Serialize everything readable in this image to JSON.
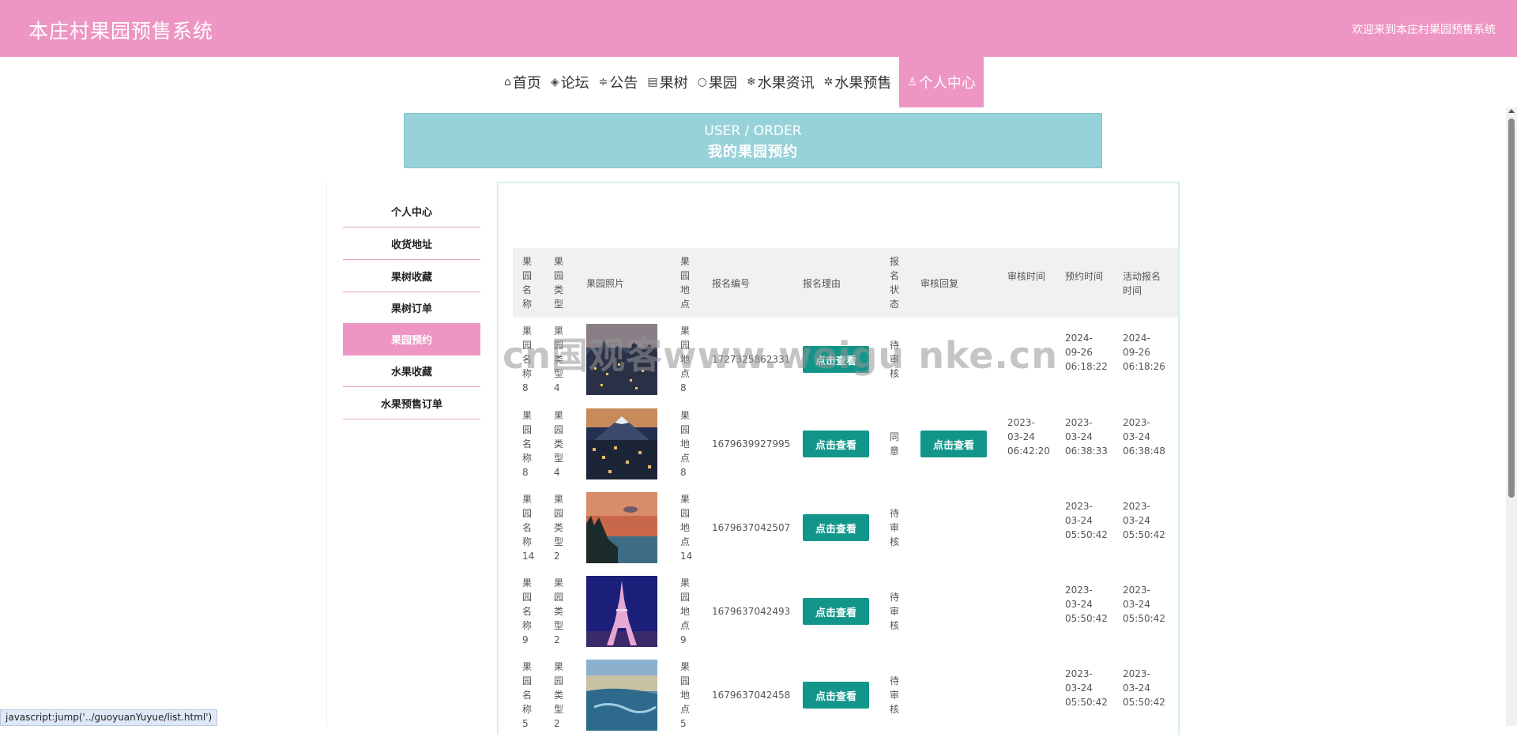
{
  "header": {
    "title": "本庄村果园预售系统",
    "welcome": "欢迎来到本庄村果园预售系统"
  },
  "nav": [
    {
      "icon": "home-icon",
      "glyph": "⌂",
      "label": "首页"
    },
    {
      "icon": "forum-icon",
      "glyph": "◈",
      "label": "论坛"
    },
    {
      "icon": "notice-icon",
      "glyph": "≑",
      "label": "公告"
    },
    {
      "icon": "tree-icon",
      "glyph": "▤",
      "label": "果树"
    },
    {
      "icon": "orchard-icon",
      "glyph": "○",
      "label": "果园"
    },
    {
      "icon": "news-icon",
      "glyph": "❄",
      "label": "水果资讯"
    },
    {
      "icon": "presale-icon",
      "glyph": "✲",
      "label": "水果预售"
    },
    {
      "icon": "user-icon",
      "glyph": "♙",
      "label": "个人中心",
      "active": true
    }
  ],
  "banner": {
    "en": "USER / ORDER",
    "zh": "我的果园预约"
  },
  "sidebar": [
    {
      "label": "个人中心"
    },
    {
      "label": "收货地址"
    },
    {
      "label": "果树收藏"
    },
    {
      "label": "果树订单"
    },
    {
      "label": "果园预约",
      "active": true
    },
    {
      "label": "水果收藏"
    },
    {
      "label": "水果预售订单"
    }
  ],
  "table": {
    "headers": [
      "果园名称",
      "果园类型",
      "果园照片",
      "果园地点",
      "报名编号",
      "报名理由",
      "报名状态",
      "审核回复",
      "审核时间",
      "预约时间",
      "活动报名时间"
    ],
    "view_label": "点击查看",
    "rows": [
      {
        "name": "果园名称8",
        "type": "果园类型4",
        "photo": "city-night",
        "place": "果园地点8",
        "code": "1727325862331",
        "status": "待审核",
        "reply": "",
        "audit_time": "",
        "book_time": "2024-09-26 06:18:22",
        "act_time": "2024-09-26 06:18:26"
      },
      {
        "name": "果园名称8",
        "type": "果园类型4",
        "photo": "mountain-city",
        "place": "果园地点8",
        "code": "1679639927995",
        "status": "同意",
        "reply": "点击查看",
        "audit_time": "2023-03-24 06:42:20",
        "book_time": "2023-03-24 06:38:33",
        "act_time": "2023-03-24 06:38:48"
      },
      {
        "name": "果园名称14",
        "type": "果园类型2",
        "photo": "lake-sunset",
        "place": "果园地点14",
        "code": "1679637042507",
        "status": "待审核",
        "reply": "",
        "audit_time": "",
        "book_time": "2023-03-24 05:50:42",
        "act_time": "2023-03-24 05:50:42"
      },
      {
        "name": "果园名称9",
        "type": "果园类型2",
        "photo": "eiffel-tower",
        "place": "果园地点9",
        "code": "1679637042493",
        "status": "待审核",
        "reply": "",
        "audit_time": "",
        "book_time": "2023-03-24 05:50:42",
        "act_time": "2023-03-24 05:50:42"
      },
      {
        "name": "果园名称5",
        "type": "果园类型2",
        "photo": "coast-aerial",
        "place": "果园地点5",
        "code": "1679637042458",
        "status": "待审核",
        "reply": "",
        "audit_time": "",
        "book_time": "2023-03-24 05:50:42",
        "act_time": "2023-03-24 05:50:42"
      }
    ]
  },
  "watermark": "cn国观客www.weigu nke.cn",
  "statusbar": "javascript:jump('../guoyuanYuyue/list.html')",
  "colors": {
    "header": "#ee96c3",
    "banner": "#98d2d9",
    "button": "#12968a"
  }
}
